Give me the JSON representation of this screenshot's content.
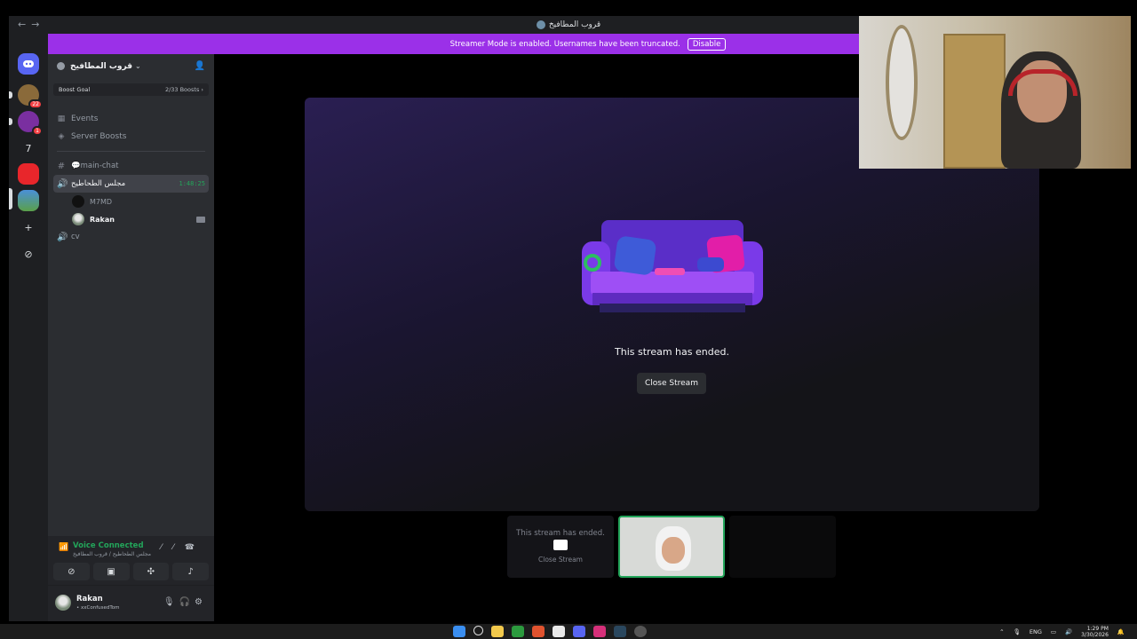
{
  "window": {
    "title": "قروب المطافيخ",
    "nav_back": "←",
    "nav_forward": "→"
  },
  "banner": {
    "message": "Streamer Mode is enabled. Usernames have been truncated.",
    "disable_label": "Disable"
  },
  "rail": {
    "badges": [
      "22",
      "1"
    ],
    "seven_label": "7",
    "add_icon": "+",
    "discover_icon": "⊘"
  },
  "server": {
    "name": "قروب المطافيخ",
    "boost_goal_label": "Boost Goal",
    "boost_count": "2/33 Boosts ›",
    "events_label": "Events",
    "server_boosts_label": "Server Boosts"
  },
  "channels": [
    {
      "label": "💬main-chat",
      "type": "text"
    },
    {
      "label": "مجلس الطحاطيح",
      "type": "voice",
      "timer": "1:48:25"
    },
    {
      "label": "cv",
      "type": "voice"
    }
  ],
  "voice_users": [
    {
      "name": "M7MD"
    },
    {
      "name": "Rakan"
    }
  ],
  "voice_panel": {
    "status": "Voice Connected",
    "location": "مجلس الطحاطيح / قروب المطافيخ"
  },
  "user_panel": {
    "name": "Rakan",
    "status": "• xxConfusedTom"
  },
  "stream": {
    "ended_text": "This stream has ended.",
    "close_label": "Close Stream"
  },
  "thumbnails": {
    "ended_text": "This stream has ended.",
    "close_label": "Close Stream"
  },
  "taskbar": {
    "lang": "ENG",
    "time": "1:29 PM",
    "date": "3/30/2026"
  },
  "colors": {
    "banner": "#9b30e8",
    "voice_green": "#23a55a",
    "sidebar": "#2b2d31",
    "background": "#1e1f22"
  }
}
